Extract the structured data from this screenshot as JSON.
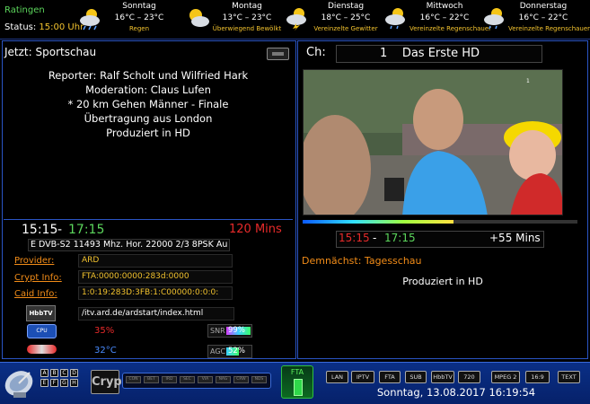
{
  "header": {
    "city": "Ratingen",
    "status_label": "Status:",
    "status_time": "15:00 Uhr",
    "forecast": [
      {
        "day": "Sonntag",
        "temp": "16°C – 23°C",
        "desc": "Regen",
        "icon": "rain-cloud-icon"
      },
      {
        "day": "Montag",
        "temp": "13°C – 23°C",
        "desc": "Überwiegend Bewölkt",
        "icon": "partly-cloudy-icon"
      },
      {
        "day": "Dienstag",
        "temp": "18°C – 25°C",
        "desc": "Vereinzelte Gewitter",
        "icon": "thunder-cloud-icon"
      },
      {
        "day": "Mittwoch",
        "temp": "16°C – 22°C",
        "desc": "Vereinzelte Regenschauer",
        "icon": "shower-cloud-icon"
      },
      {
        "day": "Donnerstag",
        "temp": "16°C – 22°C",
        "desc": "Vereinzelte Regenschauer",
        "icon": "shower-cloud-icon"
      }
    ]
  },
  "now": {
    "title": "Jetzt: Sportschau",
    "description": [
      "Reporter: Ralf Scholt und Wilfried Hark",
      "Moderation: Claus Lufen",
      "* 20 km Gehen Männer - Finale",
      "Übertragung aus London",
      "Produziert in HD"
    ],
    "start": "15:15",
    "end": "17:15",
    "dash": "-",
    "length": "120 Mins"
  },
  "tuner": {
    "transponder": "E  DVB-S2  11493 Mhz. Hor. 22000 2/3 8PSK  Au",
    "provider_label": "Provider:",
    "provider": "ARD",
    "crypt_label": "Crypt Info:",
    "crypt": "FTA:0000:0000:283d:0000",
    "caid_label": "Caid Info:",
    "caid": "1:0:19:283D:3FB:1:C00000:0:0:0:",
    "hbbtv_logo": "HbbTV",
    "hbbtv_url": "/itv.ard.de/ardstart/index.html",
    "cpu_label": "CPU",
    "cpu": "35%",
    "temperature": "32°C",
    "snr_label": "SNR",
    "snr": "99%",
    "snr_level": 0.99,
    "agc_label": "AGC",
    "agc": "52%",
    "agc_level": 0.52
  },
  "channel": {
    "label": "Ch:",
    "number": "1",
    "name": "Das Erste HD",
    "progress": 0.55
  },
  "next": {
    "start": "15:15",
    "dash": "-",
    "end": "17:15",
    "remaining": "+55 Mins",
    "coming_label": "Demnächst: Tagesschau",
    "coming_desc": "Produziert in HD"
  },
  "bottom": {
    "letters": [
      "A",
      "B",
      "C",
      "D",
      "E",
      "F",
      "G",
      "H"
    ],
    "crypt": "Crypt",
    "ca_systems": [
      "CON",
      "BET",
      "IRD",
      "SEC",
      "VIA",
      "NAG",
      "CRW",
      "NDS"
    ],
    "fta": "FTA",
    "tags": [
      "LAN",
      "IPTV",
      "FTA",
      "SUB",
      "HbbTV",
      "720",
      "MPEG 2",
      "16:9",
      "TEXT"
    ],
    "datetime": "Sonntag, 13.08.2017  16:19:54"
  }
}
